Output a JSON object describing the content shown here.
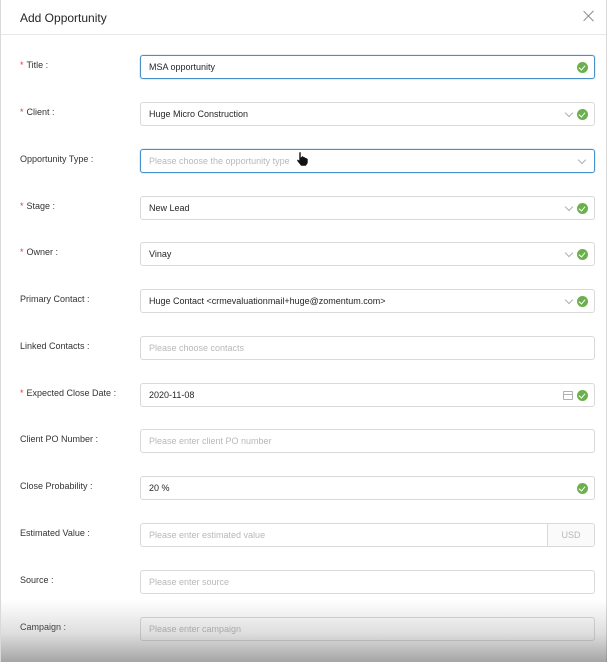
{
  "modal": {
    "title": "Add Opportunity"
  },
  "fields": {
    "title": {
      "label": "Title :",
      "required": true,
      "value": "MSA opportunity"
    },
    "client": {
      "label": "Client :",
      "required": true,
      "value": "Huge Micro Construction"
    },
    "opportunity_type": {
      "label": "Opportunity Type :",
      "required": false,
      "placeholder": "Please choose the opportunity type"
    },
    "stage": {
      "label": "Stage :",
      "required": true,
      "value": "New Lead"
    },
    "owner": {
      "label": "Owner :",
      "required": true,
      "value": "Vinay"
    },
    "primary_contact": {
      "label": "Primary Contact :",
      "required": false,
      "value": "Huge Contact <crmevaluationmail+huge@zomentum.com>"
    },
    "linked_contacts": {
      "label": "Linked Contacts :",
      "required": false,
      "placeholder": "Please choose contacts"
    },
    "expected_close_date": {
      "label": "Expected Close Date :",
      "required": true,
      "value": "2020-11-08"
    },
    "client_po_number": {
      "label": "Client PO Number :",
      "required": false,
      "placeholder": "Please enter client PO number"
    },
    "close_probability": {
      "label": "Close Probability :",
      "required": false,
      "value": "20 %"
    },
    "estimated_value": {
      "label": "Estimated Value :",
      "required": false,
      "placeholder": "Please enter estimated value",
      "currency": "USD"
    },
    "source": {
      "label": "Source :",
      "required": false,
      "placeholder": "Please enter source"
    },
    "campaign": {
      "label": "Campaign :",
      "required": false,
      "placeholder": "Please enter campaign"
    }
  },
  "required_marker": "*",
  "colors": {
    "focus_border": "#4a90c8",
    "success": "#6ab04c",
    "required": "#e53935"
  },
  "icons": [
    "close-icon",
    "check-circle-icon",
    "chevron-down-icon",
    "calendar-icon",
    "mouse-cursor-icon"
  ]
}
